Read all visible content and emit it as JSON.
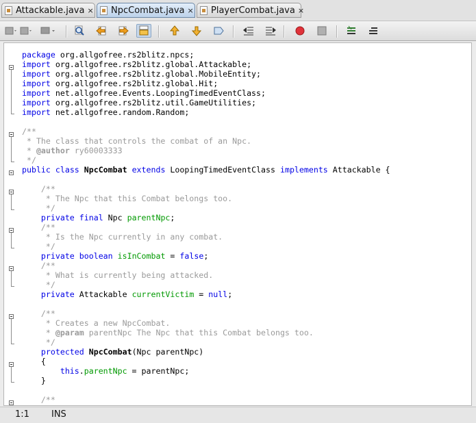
{
  "tabs": [
    {
      "label": "Attackable.java",
      "close": "×"
    },
    {
      "label": "NpcCombat.java",
      "close": "×"
    },
    {
      "label": "PlayerCombat.java",
      "close": "×"
    }
  ],
  "status": {
    "position": "1:1",
    "mode": "INS"
  },
  "code": [
    "package org.allgofree.rs2blitz.npcs;",
    "import org.allgofree.rs2blitz.global.Attackable;",
    "import org.allgofree.rs2blitz.global.MobileEntity;",
    "import org.allgofree.rs2blitz.global.Hit;",
    "import net.allgofree.Events.LoopingTimedEventClass;",
    "import org.allgofree.rs2blitz.util.GameUtilities;",
    "import net.allgofree.random.Random;",
    "",
    "/**",
    " * The class that controls the combat of an Npc.",
    " * @author ry60003333",
    " */",
    "public class NpcCombat extends LoopingTimedEventClass implements Attackable {",
    "",
    "    /**",
    "     * The Npc that this Combat belongs too.",
    "     */",
    "    private final Npc parentNpc;",
    "    /**",
    "     * Is the Npc currently in any combat.",
    "     */",
    "    private boolean isInCombat = false;",
    "    /**",
    "     * What is currently being attacked.",
    "     */",
    "    private Attackable currentVictim = null;",
    "",
    "    /**",
    "     * Creates a new NpcCombat.",
    "     * @param parentNpc The Npc that this Combat belongs too.",
    "     */",
    "    protected NpcCombat(Npc parentNpc)",
    "    {",
    "        this.parentNpc = parentNpc;",
    "    }",
    "",
    "    /**"
  ]
}
